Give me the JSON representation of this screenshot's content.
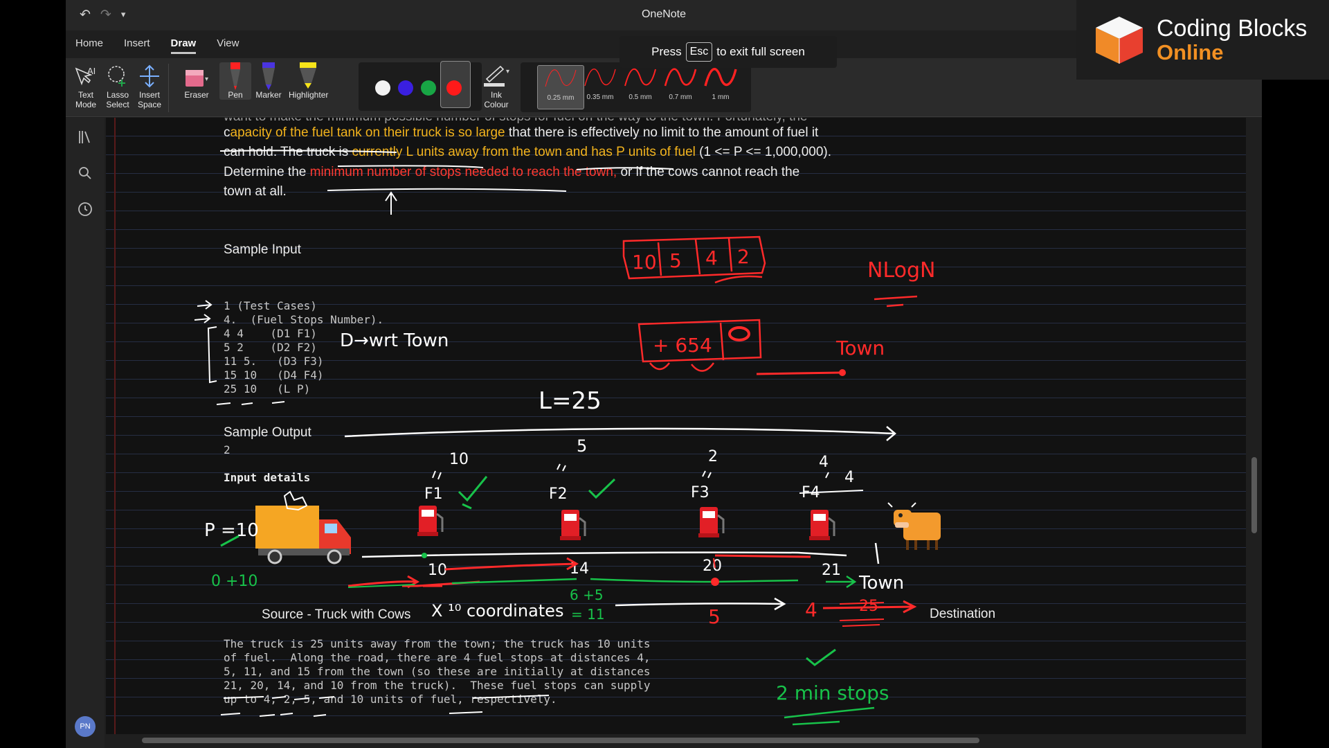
{
  "window": {
    "title": "OneNote"
  },
  "quick_access": {
    "undo_icon": "undo-icon",
    "redo_icon": "redo-icon",
    "customize_icon": "dropdown-icon"
  },
  "tabs": [
    {
      "label": "Home"
    },
    {
      "label": "Insert"
    },
    {
      "label": "Draw",
      "active": true
    },
    {
      "label": "View"
    }
  ],
  "ribbon": {
    "tools": [
      {
        "label": "Text\nMode"
      },
      {
        "label": "Lasso\nSelect"
      },
      {
        "label": "Insert\nSpace"
      },
      {
        "label": "Eraser"
      },
      {
        "label": "Pen"
      },
      {
        "label": "Marker"
      },
      {
        "label": "Highlighter"
      }
    ],
    "colors": [
      "#f2f2f2",
      "#3a1fe0",
      "#18a645",
      "#ff1a1a"
    ],
    "selected_color": "#ff1a1a",
    "ink_colour_label": "Ink\nColour",
    "thickness": [
      "0.25 mm",
      "0.35 mm",
      "0.5 mm",
      "0.7 mm",
      "1 mm"
    ],
    "selected_thickness": "0.25 mm"
  },
  "toast": {
    "pre": "Press",
    "key": "Esc",
    "post": "to exit full screen"
  },
  "branding": {
    "line1": "Coding Blocks",
    "line2": "Online"
  },
  "sidebar": {
    "avatar_initials": "PN"
  },
  "note": {
    "line_cut": "want to make the minimum possible number of stops for fuel on the way to the town. Fortunately, the",
    "line1_a": "c",
    "line1_b": "apacity of the fuel tank on their truck is so large",
    "line1_c": " that there is effectively no limit to the amount of fuel it",
    "line2_a": "can hold. The truck is ",
    "line2_b": "currently L units away from the town and has P units of fuel",
    "line2_c": " (1 <= P <= 1,000,000).",
    "line3_a": "Determine the ",
    "line3_b": "minimum number of stops needed to reach the town,",
    "line3_c": " or if the cows cannot reach the",
    "line4": "town at all.",
    "sample_input_heading": "Sample Input",
    "sample_input_lines": [
      "1 (Test Cases)",
      "4.  (Fuel Stops Number).",
      "4 4    (D1 F1)",
      "5 2    (D2 F2)",
      "11 5.   (D3 F3)",
      "15 10   (D4 F4)",
      "25 10   (L P)"
    ],
    "sample_output_heading": "Sample Output",
    "sample_output_value": "2",
    "input_details_heading": "Input details",
    "source_label": "Source - Truck with Cows",
    "destination_label": "Destination",
    "explanation_lines": [
      "The truck is 25 units away from the town; the truck has 10 units",
      "of fuel.  Along the road, there are 4 fuel stops at distances 4,",
      "5, 11, and 15 from the town (so these are initially at distances",
      "21, 20, 14, and 10 from the truck).  These fuel stops can supply",
      "up to 4, 2, 5, and 10 units of fuel, respectively."
    ]
  },
  "ink": {
    "heap_values": [
      "10",
      "5",
      "4",
      "2"
    ],
    "pq_value": "+ 654",
    "complexity": "NLogN",
    "town_1": "Town",
    "dist_label": "L=25",
    "towards_town": "D→wrt Town",
    "p_label": "P =10",
    "fuel_stop_labels": [
      "F1",
      "F2",
      "F3",
      "F4"
    ],
    "fuel_amounts": [
      "10",
      "5",
      "2",
      "4"
    ],
    "f4_extra": "4",
    "positions": [
      "10",
      "14",
      "20",
      "21"
    ],
    "town_2": "Town",
    "fuel_calc": "0 +10",
    "coordinates_note": "X ¹⁰ coordinates",
    "calc_1": "6 +5",
    "calc_2": "= 11",
    "red_5": "5",
    "red_4": "4",
    "red_25": "25",
    "answer": "2 min stops"
  }
}
